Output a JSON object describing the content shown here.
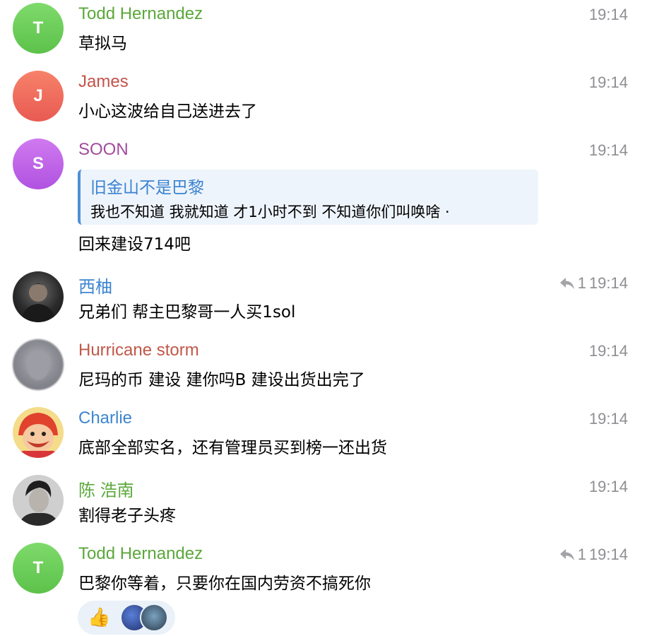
{
  "messages": [
    {
      "name": "Todd Hernandez",
      "name_color": "#5aa83a",
      "initial": "T",
      "avatar_color": "#6ecf5c",
      "text": "草拟马",
      "time": "19:14",
      "replies": ""
    },
    {
      "name": "James",
      "name_color": "#c4524a",
      "initial": "J",
      "avatar_color": "#ef6b5a",
      "text": "小心这波给自己送进去了",
      "time": "19:14",
      "replies": ""
    },
    {
      "name": "SOON",
      "name_color": "#a14c9c",
      "initial": "S",
      "avatar_color": "#bf5fe6",
      "text": "回来建设714吧",
      "time": "19:14",
      "replies": "",
      "quote": {
        "title": "旧金山不是巴黎",
        "text": "我也不知道 我就知道 才1小时不到 不知道你们叫唤啥 ·"
      }
    },
    {
      "name": "西柚",
      "name_color": "#3d86d0",
      "text": "兄弟们 帮主巴黎哥一人买1sol",
      "time": "19:14",
      "replies": "1"
    },
    {
      "name": "Hurricane storm",
      "name_color": "#c05848",
      "text": "尼玛的币 建设 建你吗B 建设出货出完了",
      "time": "19:14",
      "replies": ""
    },
    {
      "name": "Charlie",
      "name_color": "#3d86d0",
      "text": "底部全部实名，还有管理员买到榜一还出货",
      "time": "19:14",
      "replies": ""
    },
    {
      "name": "陈 浩南",
      "name_color": "#5aa83a",
      "text": "割得老子头疼",
      "time": "19:14",
      "replies": ""
    },
    {
      "name": "Todd Hernandez",
      "name_color": "#5aa83a",
      "initial": "T",
      "avatar_color": "#6ecf5c",
      "text": "巴黎你等着，只要你在国内劳资不搞死你",
      "time": "19:14",
      "replies": "1"
    }
  ],
  "reaction": {
    "emoji": "👍"
  }
}
